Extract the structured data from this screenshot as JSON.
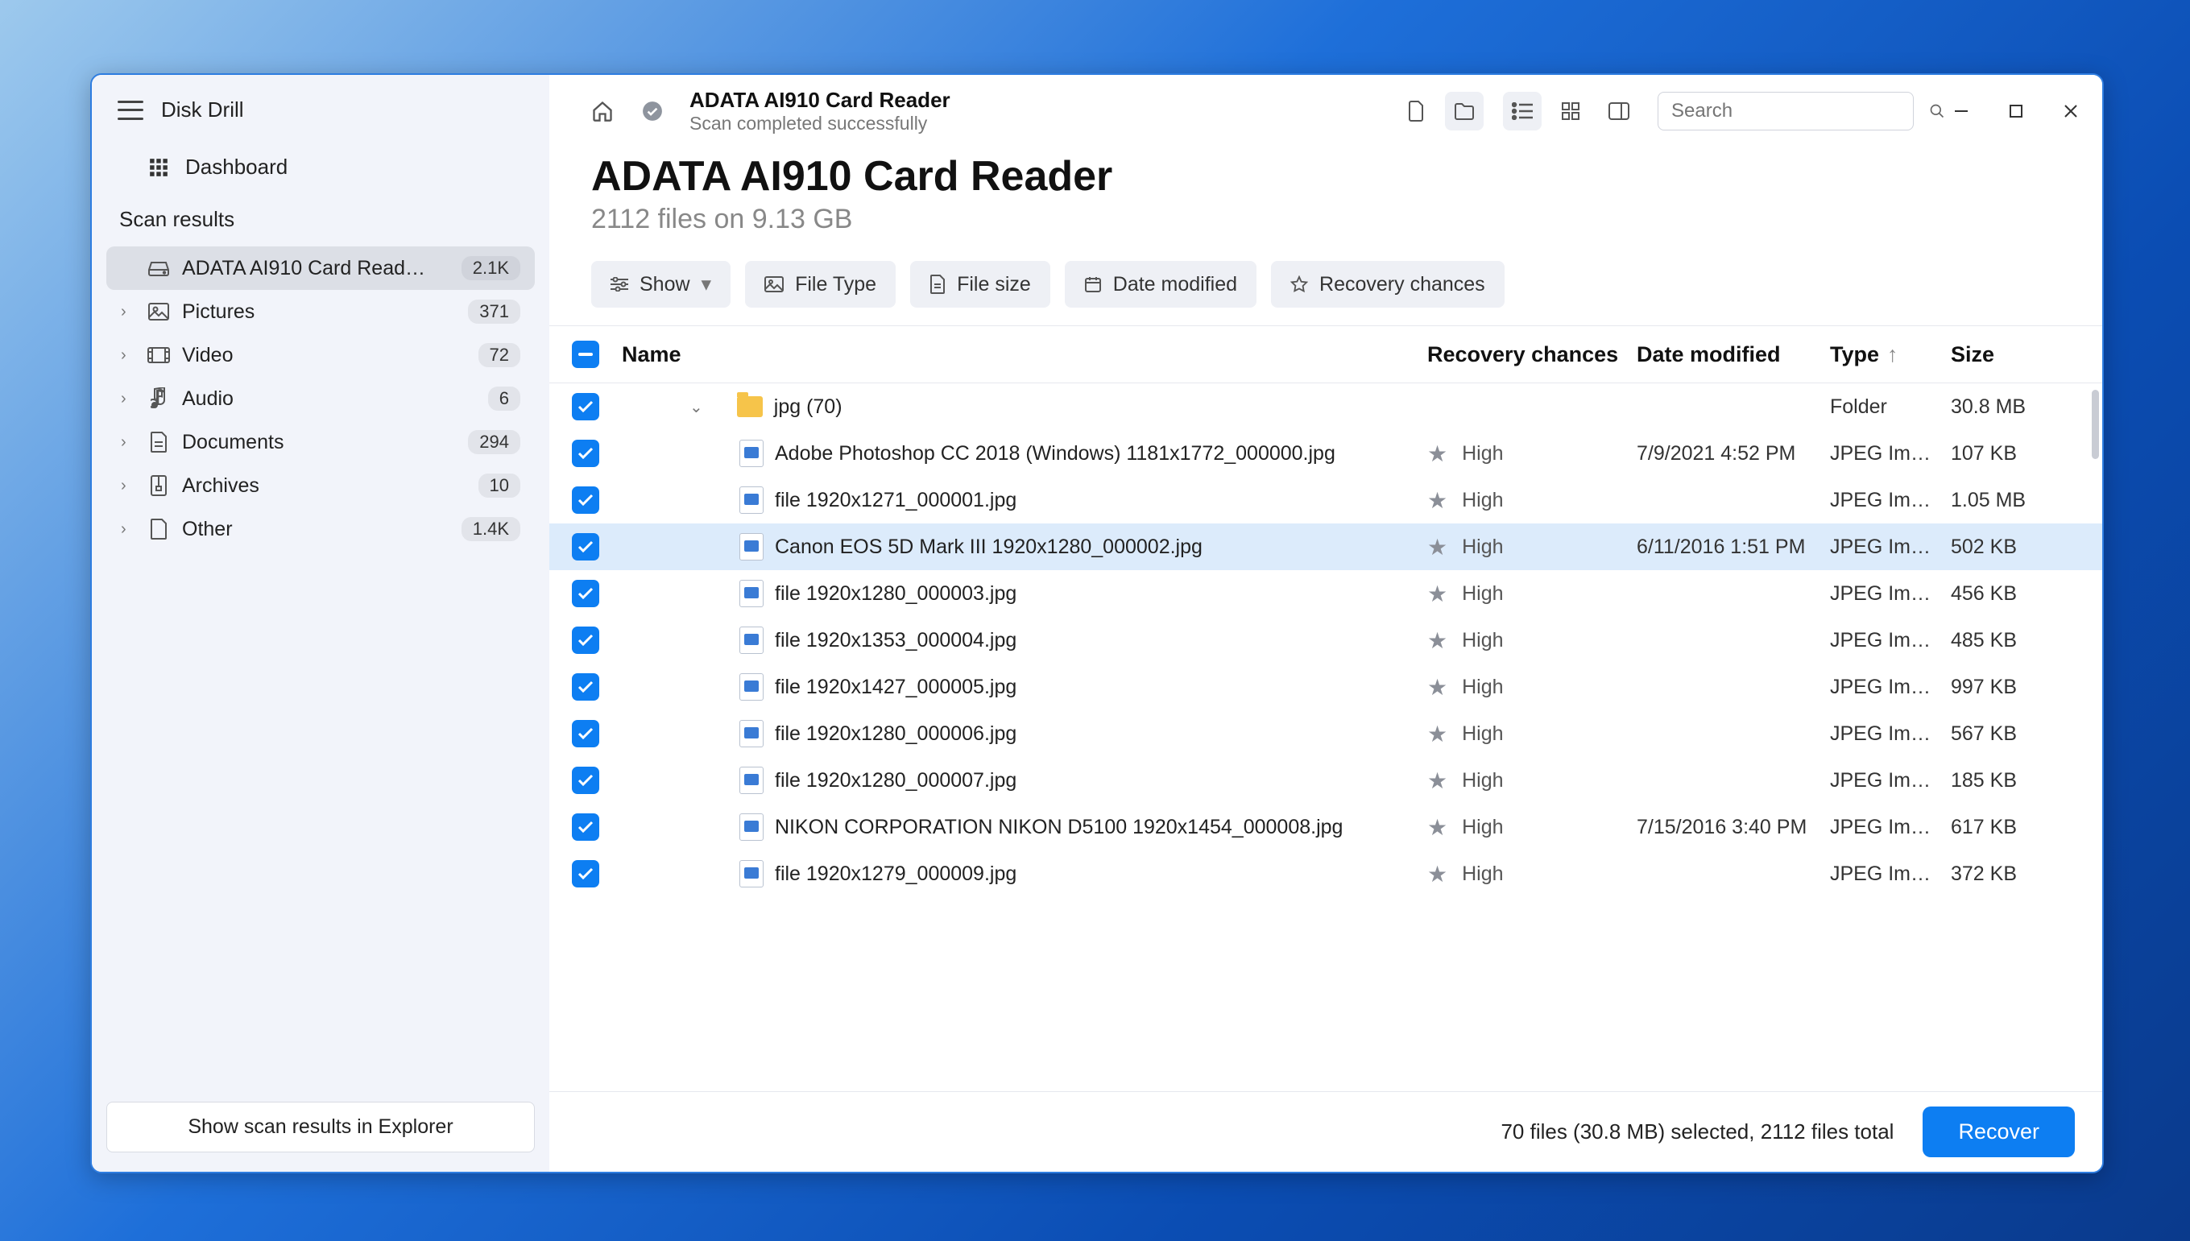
{
  "app": {
    "title": "Disk Drill"
  },
  "sidebar": {
    "dashboard": "Dashboard",
    "section": "Scan results",
    "tree": [
      {
        "icon": "drive",
        "label": "ADATA AI910 Card Read…",
        "count": "2.1K",
        "selected": true,
        "chev": ""
      },
      {
        "icon": "picture",
        "label": "Pictures",
        "count": "371",
        "chev": "›"
      },
      {
        "icon": "video",
        "label": "Video",
        "count": "72",
        "chev": "›"
      },
      {
        "icon": "audio",
        "label": "Audio",
        "count": "6",
        "chev": "›"
      },
      {
        "icon": "document",
        "label": "Documents",
        "count": "294",
        "chev": "›"
      },
      {
        "icon": "archive",
        "label": "Archives",
        "count": "10",
        "chev": "›"
      },
      {
        "icon": "other",
        "label": "Other",
        "count": "1.4K",
        "chev": "›"
      }
    ],
    "explorer_btn": "Show scan results in Explorer"
  },
  "titlebar": {
    "title": "ADATA AI910 Card Reader",
    "subtitle": "Scan completed successfully",
    "search_placeholder": "Search"
  },
  "page": {
    "heading": "ADATA AI910 Card Reader",
    "subheading": "2112 files on 9.13 GB"
  },
  "filters": {
    "show": "Show",
    "file_type": "File Type",
    "file_size": "File size",
    "date_modified": "Date modified",
    "recovery_chances": "Recovery chances"
  },
  "columns": {
    "name": "Name",
    "recovery": "Recovery chances",
    "date": "Date modified",
    "type": "Type",
    "size": "Size"
  },
  "folder_row": {
    "name": "jpg (70)",
    "type": "Folder",
    "size": "30.8 MB"
  },
  "rows": [
    {
      "name": "Adobe Photoshop CC 2018 (Windows) 1181x1772_000000.jpg",
      "rec": "High",
      "date": "7/9/2021 4:52 PM",
      "type": "JPEG Im…",
      "size": "107 KB",
      "hl": false
    },
    {
      "name": "file 1920x1271_000001.jpg",
      "rec": "High",
      "date": "",
      "type": "JPEG Im…",
      "size": "1.05 MB",
      "hl": false
    },
    {
      "name": "Canon EOS 5D Mark III 1920x1280_000002.jpg",
      "rec": "High",
      "date": "6/11/2016 1:51 PM",
      "type": "JPEG Im…",
      "size": "502 KB",
      "hl": true
    },
    {
      "name": "file 1920x1280_000003.jpg",
      "rec": "High",
      "date": "",
      "type": "JPEG Im…",
      "size": "456 KB",
      "hl": false
    },
    {
      "name": "file 1920x1353_000004.jpg",
      "rec": "High",
      "date": "",
      "type": "JPEG Im…",
      "size": "485 KB",
      "hl": false
    },
    {
      "name": "file 1920x1427_000005.jpg",
      "rec": "High",
      "date": "",
      "type": "JPEG Im…",
      "size": "997 KB",
      "hl": false
    },
    {
      "name": "file 1920x1280_000006.jpg",
      "rec": "High",
      "date": "",
      "type": "JPEG Im…",
      "size": "567 KB",
      "hl": false
    },
    {
      "name": "file 1920x1280_000007.jpg",
      "rec": "High",
      "date": "",
      "type": "JPEG Im…",
      "size": "185 KB",
      "hl": false
    },
    {
      "name": "NIKON CORPORATION NIKON D5100 1920x1454_000008.jpg",
      "rec": "High",
      "date": "7/15/2016 3:40 PM",
      "type": "JPEG Im…",
      "size": "617 KB",
      "hl": false
    },
    {
      "name": "file 1920x1279_000009.jpg",
      "rec": "High",
      "date": "",
      "type": "JPEG Im…",
      "size": "372 KB",
      "hl": false
    }
  ],
  "footer": {
    "status": "70 files (30.8 MB) selected, 2112 files total",
    "recover": "Recover"
  }
}
